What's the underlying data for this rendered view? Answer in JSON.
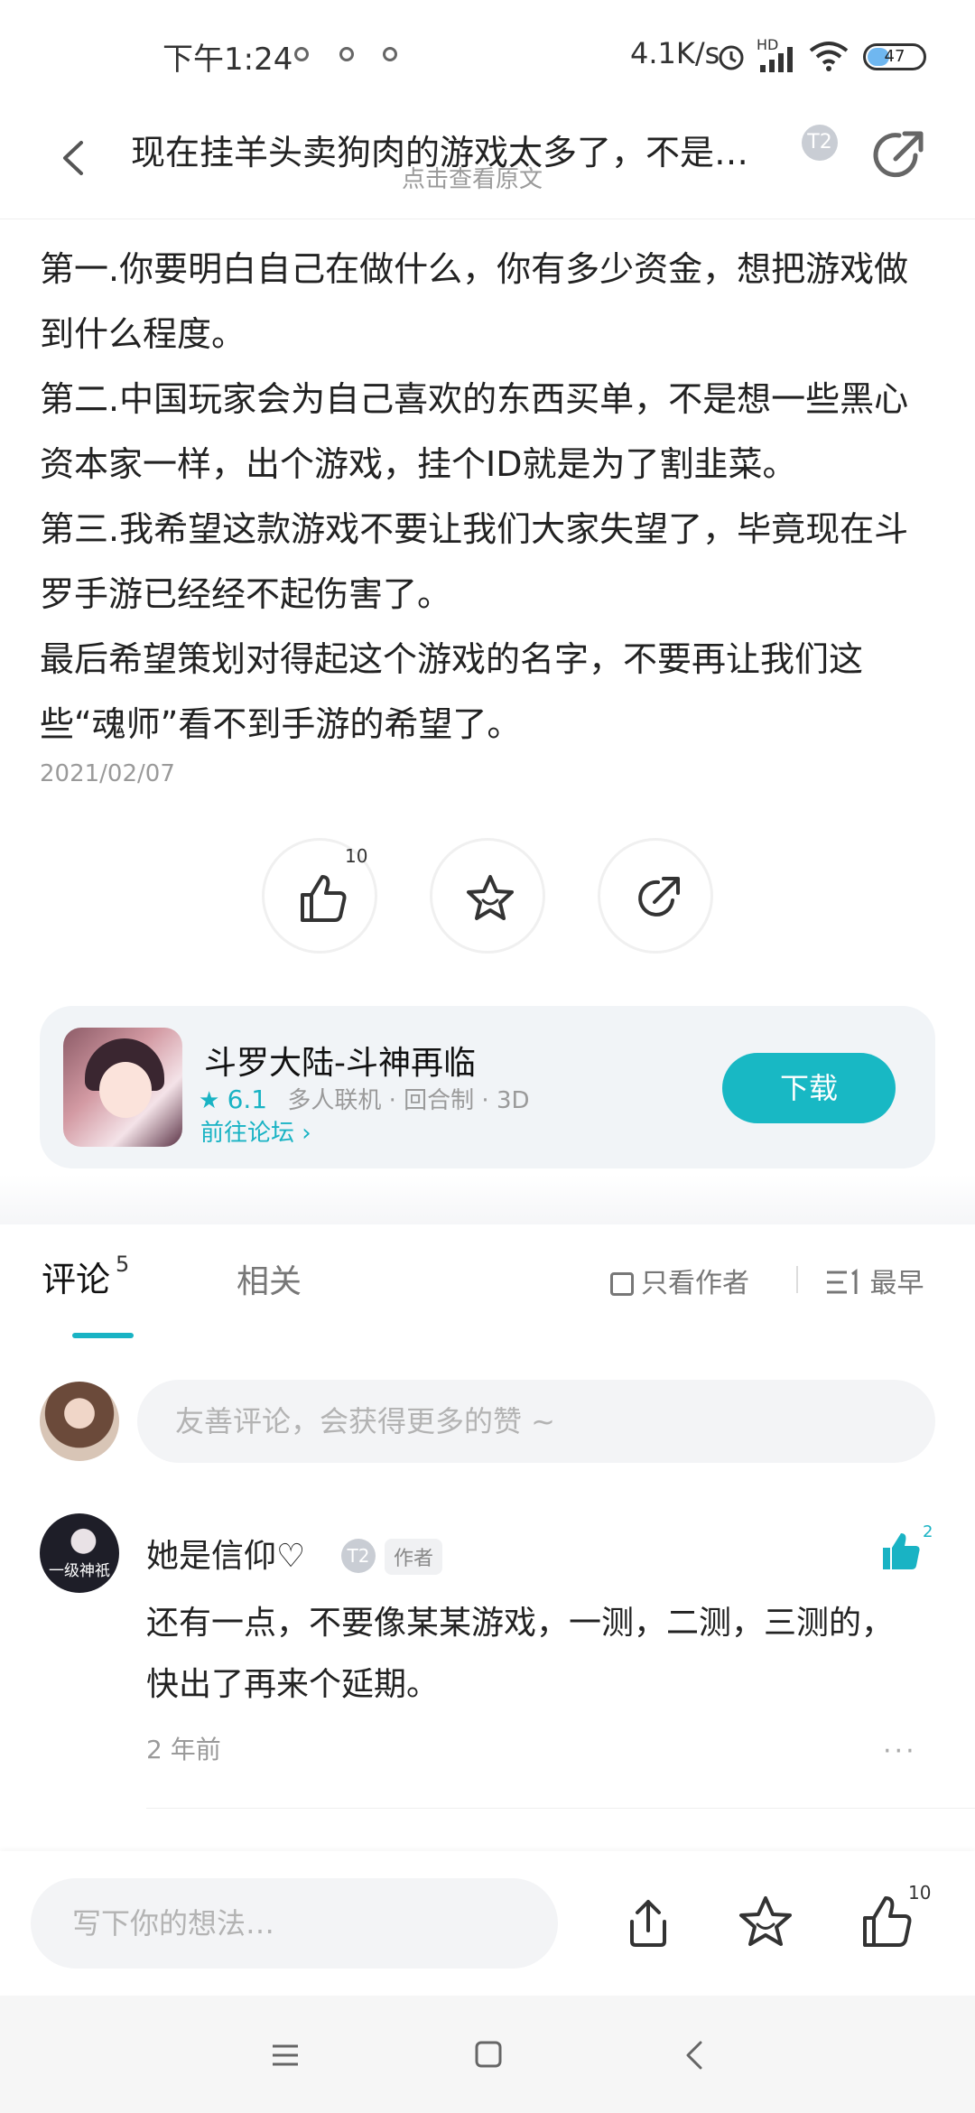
{
  "status_bar": {
    "time": "下午1:24",
    "network_speed": "4.1K/s",
    "hd_label": "HD",
    "battery": "47"
  },
  "header": {
    "title": "现在挂羊头卖狗肉的游戏太多了，不是…",
    "subtitle": "点击查看原文",
    "level_badge": "T2",
    "icons": {
      "back": "back-arrow-icon",
      "share": "share-icon"
    }
  },
  "post": {
    "paragraphs": [
      "第一.你要明白自己在做什么，你有多少资金，想把游戏做到什么程度。",
      "第二.中国玩家会为自己喜欢的东西买单，不是想一些黑心资本家一样，出个游戏，挂个ID就是为了割韭菜。",
      "第三.我希望这款游戏不要让我们大家失望了，毕竟现在斗罗手游已经经不起伤害了。",
      "最后希望策划对得起这个游戏的名字，不要再让我们这些“魂师”看不到手游的希望了。"
    ],
    "date": "2021/02/07",
    "actions": {
      "like_count": "10"
    }
  },
  "game_card": {
    "name": "斗罗大陆-斗神再临",
    "score": "6.1",
    "tags": "多人联机 · 回合制 · 3D",
    "forum_link": "前往论坛",
    "download_label": "下载"
  },
  "comments_section": {
    "tab_comments": "评论",
    "comment_count": "5",
    "tab_related": "相关",
    "only_author": "只看作者",
    "sort": "最早",
    "input_placeholder": "友善评论，会获得更多的赞 ~",
    "items": [
      {
        "user": "她是信仰♡",
        "avatar_tag": "一级神祇",
        "level_badge": "T2",
        "role": "作者",
        "like_count": "2",
        "text": "还有一点，不要像某某游戏，一测，二测，三测的，快出了再来个延期。",
        "time": "2 年前",
        "more": "···"
      }
    ]
  },
  "bottom_bar": {
    "input_placeholder": "写下你的想法…",
    "like_count": "10"
  },
  "colors": {
    "accent": "#19b3c4",
    "text_primary": "#222222",
    "text_secondary": "#9a9a9a"
  }
}
